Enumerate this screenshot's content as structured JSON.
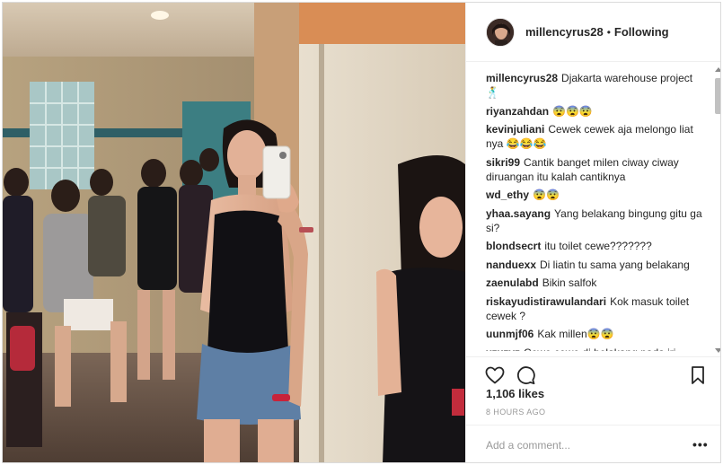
{
  "post": {
    "username": "millencyrus28",
    "separator": "•",
    "follow_status": "Following",
    "caption": {
      "username": "millencyrus28",
      "text": "Djakarta warehouse project",
      "icon": "🕺"
    },
    "comments": [
      {
        "username": "riyanzahdan",
        "text": "😨😨😨"
      },
      {
        "username": "kevinjuliani",
        "text": "Cewek cewek aja melongo liat nya 😂😂😂"
      },
      {
        "username": "sikri99",
        "text": "Cantik banget milen ciway ciway diruangan itu kalah cantiknya"
      },
      {
        "username": "wd_ethy",
        "text": "😨😨"
      },
      {
        "username": "yhaa.sayang",
        "text": "Yang belakang bingung gitu ga si?"
      },
      {
        "username": "blondsecrt",
        "text": "itu toilet cewe???????"
      },
      {
        "username": "nanduexx",
        "text": "Di liatin tu sama yang belakang"
      },
      {
        "username": "zaenulabd",
        "text": "Bikin salfok"
      },
      {
        "username": "riskayudistirawulandari",
        "text": "Kok masuk toilet cewek ?"
      },
      {
        "username": "uunmjf06",
        "text": "Kak millen😨😨"
      },
      {
        "username": "xzxzvz",
        "text": "Cewe cewe di belakang pada iri."
      }
    ],
    "likes": "1,106 likes",
    "time": "8 HOURS AGO",
    "comment_placeholder": "Add a comment...",
    "more_label": "•••"
  },
  "icons": {
    "like": "heart-outline-icon",
    "comment": "speech-bubble-icon",
    "save": "bookmark-icon",
    "more": "ellipsis-icon"
  },
  "colors": {
    "text": "#262626",
    "muted": "#999999",
    "border": "#efefef"
  }
}
